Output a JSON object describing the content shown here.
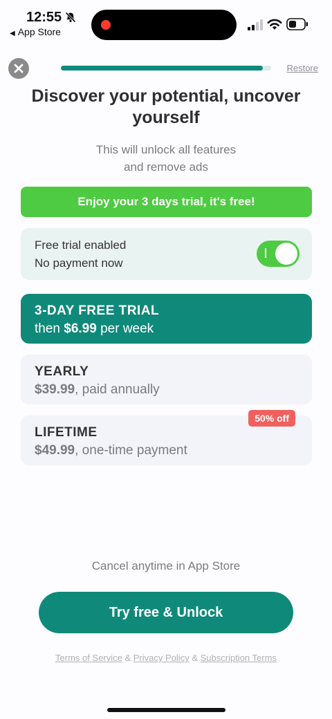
{
  "status_bar": {
    "time": "12:55",
    "back_app": "App Store"
  },
  "header": {
    "progress_percent": 96,
    "restore_label": "Restore"
  },
  "title": "Discover your potential, uncover yourself",
  "subtitle_line1": "This will unlock all features",
  "subtitle_line2": "and remove ads",
  "trial_banner": "Enjoy your 3 days trial, it's free!",
  "trial_toggle": {
    "title": "Free trial enabled",
    "subtitle": "No payment now",
    "enabled": true
  },
  "plans": [
    {
      "name": "3-DAY FREE TRIAL",
      "prefix": "then ",
      "price": "$6.99",
      "suffix": " per week",
      "selected": true
    },
    {
      "name": "YEARLY",
      "prefix": "",
      "price": "$39.99",
      "suffix": ", paid annually",
      "selected": false
    },
    {
      "name": "LIFETIME",
      "prefix": "",
      "price": "$49.99",
      "suffix": ", one-time payment",
      "selected": false,
      "badge": "50% off"
    }
  ],
  "cancel_note": "Cancel anytime in App Store",
  "cta_label": "Try free & Unlock",
  "legal": {
    "terms": "Terms of Service",
    "sep1": "&",
    "privacy": "Privacy Policy",
    "sep2": "&",
    "subscription": "Subscription Terms"
  },
  "colors": {
    "accent": "#0f8a7a",
    "green": "#4ecb42",
    "badge": "#f0605e"
  }
}
